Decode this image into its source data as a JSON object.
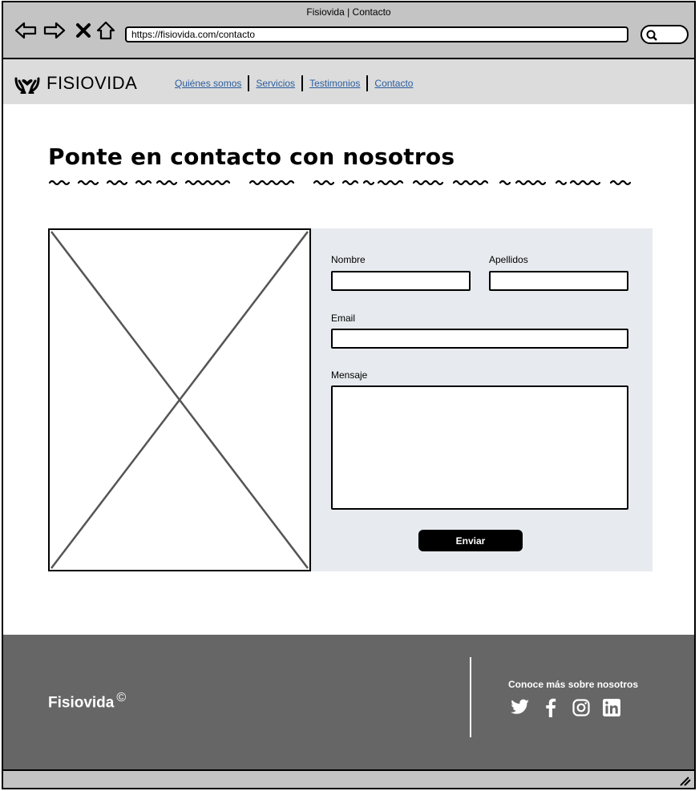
{
  "browser": {
    "window_title": "Fisiovida | Contacto",
    "url": "https://fisiovida.com/contacto"
  },
  "header": {
    "logo_text": "FISIOVIDA",
    "nav": [
      {
        "label": "Quiénes somos"
      },
      {
        "label": "Servicios"
      },
      {
        "label": "Testimonios"
      },
      {
        "label": "Contacto"
      }
    ],
    "link_color": "#2a5d9e"
  },
  "main": {
    "title": "Ponte en contacto con nosotros",
    "image_placeholder": "image-placeholder",
    "form": {
      "first_name_label": "Nombre",
      "last_name_label": "Apellidos",
      "email_label": "Email",
      "message_label": "Mensaje",
      "first_name_value": "",
      "last_name_value": "",
      "email_value": "",
      "message_value": "",
      "submit_label": "Enviar"
    }
  },
  "footer": {
    "brand": "Fisiovida",
    "copyright_symbol": "©",
    "social_title": "Conoce más sobre nosotros",
    "social_icons": [
      "twitter-icon",
      "facebook-icon",
      "instagram-icon",
      "linkedin-icon"
    ]
  },
  "colors": {
    "chrome": "#c4c4c4",
    "header_bg": "#dcdcdc",
    "form_bg": "#e7eaee",
    "footer_bg": "#666666",
    "button_bg": "#000000"
  }
}
